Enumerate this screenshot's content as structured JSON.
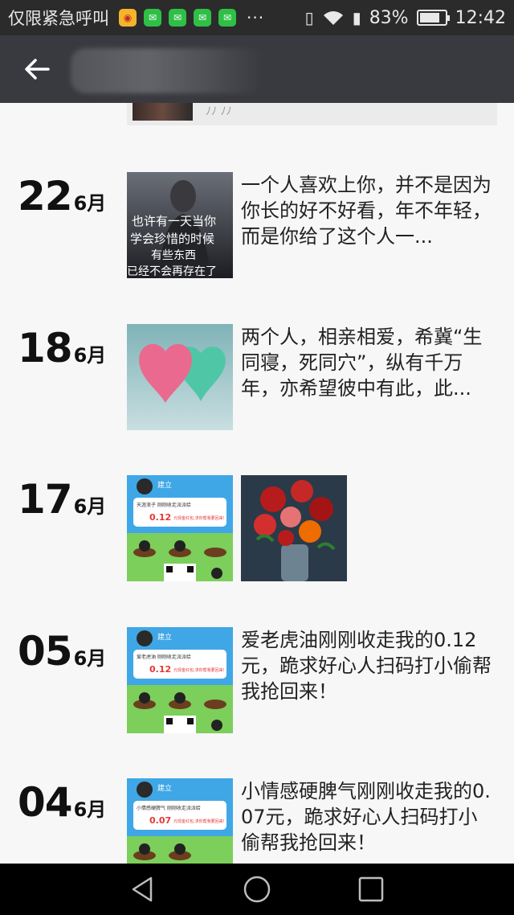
{
  "status_bar": {
    "carrier": "仅限紧急呼叫",
    "notifications": [
      "weibo-icon",
      "wechat-icon",
      "wechat-icon",
      "wechat-icon",
      "wechat-icon"
    ],
    "more": "···",
    "battery_percent": "83%",
    "battery_level": 0.83,
    "time": "12:42"
  },
  "app_bar": {
    "back_icon": "arrow-left-icon",
    "title": ""
  },
  "prev_card_text": "ﾉﾉ ﾉﾉ",
  "posts": [
    {
      "day": "22",
      "month": "6月",
      "text": "一个人喜欢上你，并不是因为你长的好不好看，年不年轻，而是你给了这个人一...",
      "images": [
        "man-poem-image"
      ]
    },
    {
      "day": "18",
      "month": "6月",
      "text": "两个人，相亲相爱，希冀“生同寝，死同穴”，纵有千万年，亦希望彼中有此，此...",
      "images": [
        "two-hearts-image"
      ]
    },
    {
      "day": "17",
      "month": "6月",
      "text": "",
      "images": [
        "game-screenshot-image",
        "red-flowers-image"
      ]
    },
    {
      "day": "05",
      "month": "6月",
      "text": "爱老虎油刚刚收走我的0.12元，跪求好心人扫码打小偷帮我抢回来！",
      "images": [
        "game-screenshot-image"
      ]
    },
    {
      "day": "04",
      "month": "6月",
      "text": "小情感硬脾气刚刚收走我的0.07元，跪求好心人扫码打小偷帮我抢回来！",
      "images": [
        "game-screenshot-image"
      ]
    }
  ],
  "game_cards": {
    "card1": {
      "name": "建立",
      "line": "天涯浪子 刚刚收走派派给",
      "amount": "0.12",
      "note": "元现金红包,求你帮我要回来!"
    },
    "card2": {
      "name": "建立",
      "line": "爱老虎油 刚刚收走派派给",
      "amount": "0.12",
      "note": "元现金红包,求你帮我要回来!"
    },
    "card3": {
      "name": "建立",
      "line": "小情感硬脾气 刚刚收走派派给",
      "amount": "0.07",
      "note": "元现金红包,求你帮我要回来!"
    }
  },
  "poem_overlay": [
    "也许有一天当你",
    "学会珍惜的时候",
    "有些东西",
    "已经不会再存在了"
  ],
  "nav_bar": {
    "back": "nav-back-icon",
    "home": "nav-home-icon",
    "recents": "nav-recents-icon"
  }
}
